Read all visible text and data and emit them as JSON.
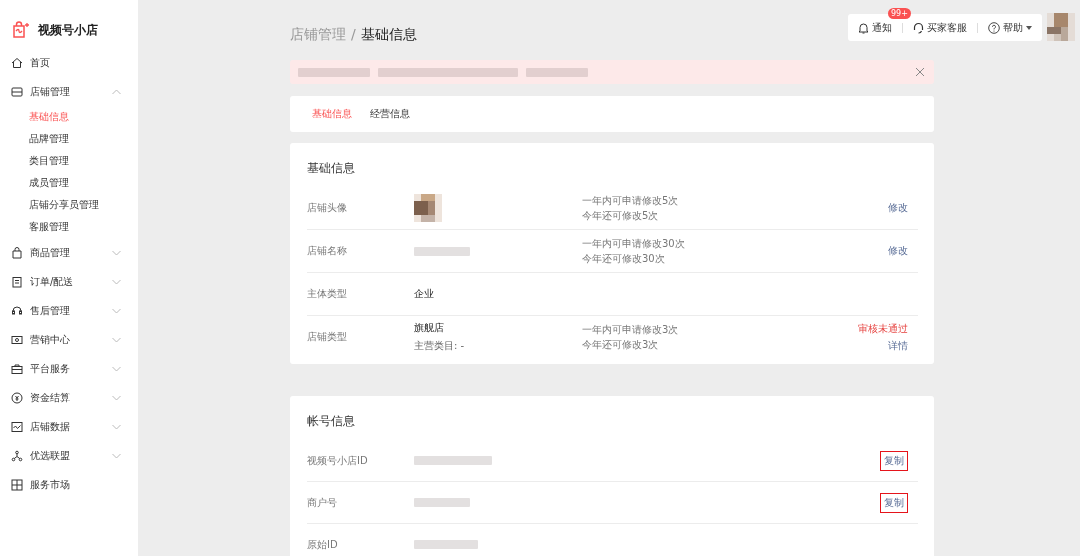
{
  "brand": {
    "name": "视频号小店"
  },
  "sidebar": {
    "items": [
      {
        "label": "首页"
      },
      {
        "label": "店铺管理",
        "expanded": true,
        "children": [
          {
            "label": "基础信息",
            "selected": true
          },
          {
            "label": "品牌管理",
            "selected": false
          },
          {
            "label": "类目管理",
            "selected": false
          },
          {
            "label": "成员管理",
            "selected": false
          },
          {
            "label": "店铺分享员管理",
            "selected": false
          },
          {
            "label": "客服管理",
            "selected": false
          }
        ]
      },
      {
        "label": "商品管理",
        "expanded": false
      },
      {
        "label": "订单/配送",
        "expanded": false
      },
      {
        "label": "售后管理",
        "expanded": false
      },
      {
        "label": "营销中心",
        "expanded": false
      },
      {
        "label": "平台服务",
        "expanded": false
      },
      {
        "label": "资金结算",
        "expanded": false
      },
      {
        "label": "店铺数据",
        "expanded": false
      },
      {
        "label": "优选联盟",
        "expanded": false
      },
      {
        "label": "服务市场"
      }
    ]
  },
  "header": {
    "notice": {
      "label": "通知",
      "badge": "99+"
    },
    "service": {
      "label": "买家客服"
    },
    "help": {
      "label": "帮助"
    }
  },
  "breadcrumb": {
    "parent": "店铺管理",
    "separator": "/",
    "current": "基础信息"
  },
  "tabs": [
    {
      "label": "基础信息",
      "selected": true
    },
    {
      "label": "经营信息",
      "selected": false
    }
  ],
  "basic_info": {
    "title": "基础信息",
    "rows": [
      {
        "label": "店铺头像",
        "kind": "avatar",
        "notes": [
          "一年内可申请修改5次",
          "今年还可修改5次"
        ],
        "actions": [
          "修改"
        ]
      },
      {
        "label": "店铺名称",
        "kind": "blurred",
        "notes": [
          "一年内可申请修改30次",
          "今年还可修改30次"
        ],
        "actions": [
          "修改"
        ]
      },
      {
        "label": "主体类型",
        "kind": "text",
        "value": "企业"
      },
      {
        "label": "店铺类型",
        "kind": "text",
        "value": "旗舰店",
        "sub": "主营类目: -",
        "notes": [
          "一年内可申请修改3次",
          "今年还可修改3次"
        ],
        "status": "审核未通过",
        "actions": [
          "详情"
        ]
      }
    ]
  },
  "account_info": {
    "title": "帐号信息",
    "rows": [
      {
        "label": "视频号小店ID",
        "action": "复制",
        "highlighted": true
      },
      {
        "label": "商户号",
        "action": "复制",
        "highlighted": true
      },
      {
        "label": "原始ID"
      }
    ]
  }
}
